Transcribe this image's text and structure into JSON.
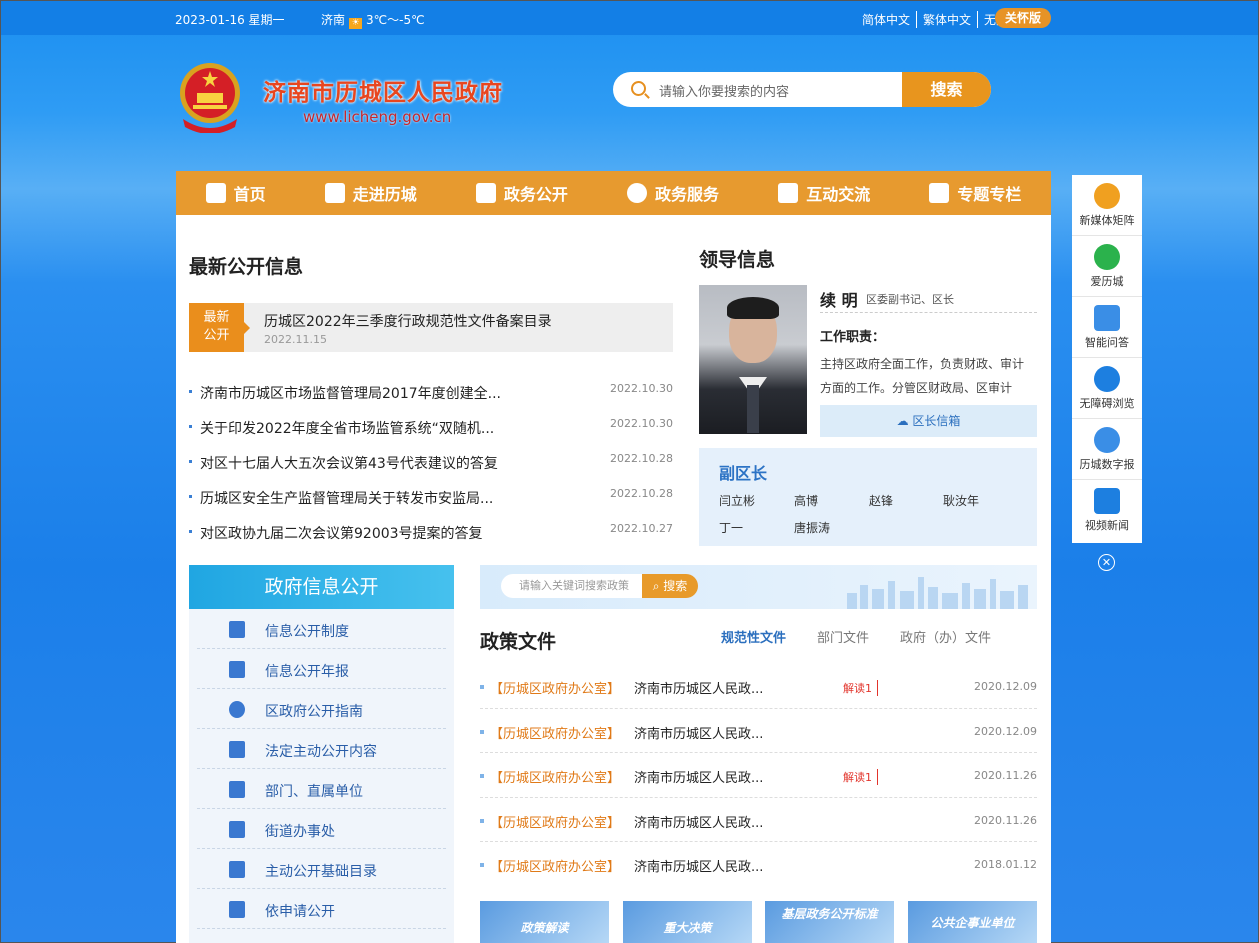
{
  "topbar": {
    "date": "2023-01-16 星期一",
    "city": "济南",
    "temp": "3℃～-5℃",
    "links": [
      "简体中文",
      "繁体中文",
      "无障碍浏览"
    ],
    "care": "关怀版"
  },
  "header": {
    "name": "济南市历城区人民政府",
    "url": "www.licheng.gov.cn"
  },
  "search": {
    "placeholder": "请输入你要搜索的内容",
    "button": "搜索"
  },
  "nav": [
    {
      "label": "首页",
      "icon": "home-icon"
    },
    {
      "label": "走进历城",
      "icon": "document-icon"
    },
    {
      "label": "政务公开",
      "icon": "book-icon"
    },
    {
      "label": "政务服务",
      "icon": "grid-icon"
    },
    {
      "label": "互动交流",
      "icon": "chat-icon"
    },
    {
      "label": "专题专栏",
      "icon": "folder-icon"
    }
  ],
  "latest": {
    "title": "最新公开信息",
    "tag": "最新公开",
    "featured": {
      "title": "历城区2022年三季度行政规范性文件备案目录",
      "date": "2022.11.15"
    },
    "items": [
      {
        "title": "济南市历城区市场监督管理局2017年度创建全...",
        "date": "2022.10.30"
      },
      {
        "title": "关于印发2022年度全省市场监管系统“双随机...",
        "date": "2022.10.30"
      },
      {
        "title": "对区十七届人大五次会议第43号代表建议的答复",
        "date": "2022.10.28"
      },
      {
        "title": "历城区安全生产监督管理局关于转发市安监局...",
        "date": "2022.10.28"
      },
      {
        "title": "对区政协九届二次会议第92003号提案的答复",
        "date": "2022.10.27"
      }
    ]
  },
  "leader": {
    "title": "领导信息",
    "name": "续 明",
    "role": "区委副书记、区长",
    "duty_label": "工作职责：",
    "duty": "主持区政府全面工作，负责财政、审计方面的工作。分管区财政局、区审计局。",
    "mail": "区长信箱"
  },
  "deputy": {
    "title": "副区长",
    "names": [
      "闫立彬",
      "高博",
      "赵锋",
      "耿汝年",
      "丁一",
      "唐振涛"
    ]
  },
  "gov": {
    "title": "政府信息公开",
    "items": [
      "信息公开制度",
      "信息公开年报",
      "区政府公开指南",
      "法定主动公开内容",
      "部门、直属单位",
      "街道办事处",
      "主动公开基础目录",
      "依申请公开"
    ]
  },
  "policy": {
    "search_placeholder": "请输入关键词搜索政策",
    "search_btn": "搜索",
    "title": "政策文件",
    "tabs": [
      "规范性文件",
      "部门文件",
      "政府（办）文件"
    ],
    "items": [
      {
        "src": "【历城区政府办公室】",
        "title": "济南市历城区人民政...",
        "jd": "解读1",
        "date": "2020.12.09"
      },
      {
        "src": "【历城区政府办公室】",
        "title": "济南市历城区人民政...",
        "jd": "",
        "date": "2020.12.09"
      },
      {
        "src": "【历城区政府办公室】",
        "title": "济南市历城区人民政...",
        "jd": "解读1",
        "date": "2020.11.26"
      },
      {
        "src": "【历城区政府办公室】",
        "title": "济南市历城区人民政...",
        "jd": "",
        "date": "2020.11.26"
      },
      {
        "src": "【历城区政府办公室】",
        "title": "济南市历城区人民政...",
        "jd": "",
        "date": "2018.01.12"
      }
    ],
    "thumbs": [
      "政策解读",
      "重大决策",
      "基层政务公开标准",
      "公共企事业单位"
    ]
  },
  "sidebar": [
    {
      "label": "新媒体矩阵",
      "icon": "phone-icon",
      "color": "#f0a020"
    },
    {
      "label": "爱历城",
      "icon": "wechat-icon",
      "color": "#2bb24c"
    },
    {
      "label": "智能问答",
      "icon": "question-icon",
      "color": "#3a8ee6"
    },
    {
      "label": "无障碍浏览",
      "icon": "eye-icon",
      "color": "#1d7fe0"
    },
    {
      "label": "历城数字报",
      "icon": "newspaper-icon",
      "color": "#3a8ee6"
    },
    {
      "label": "视频新闻",
      "icon": "video-icon",
      "color": "#1d7fe0"
    }
  ]
}
